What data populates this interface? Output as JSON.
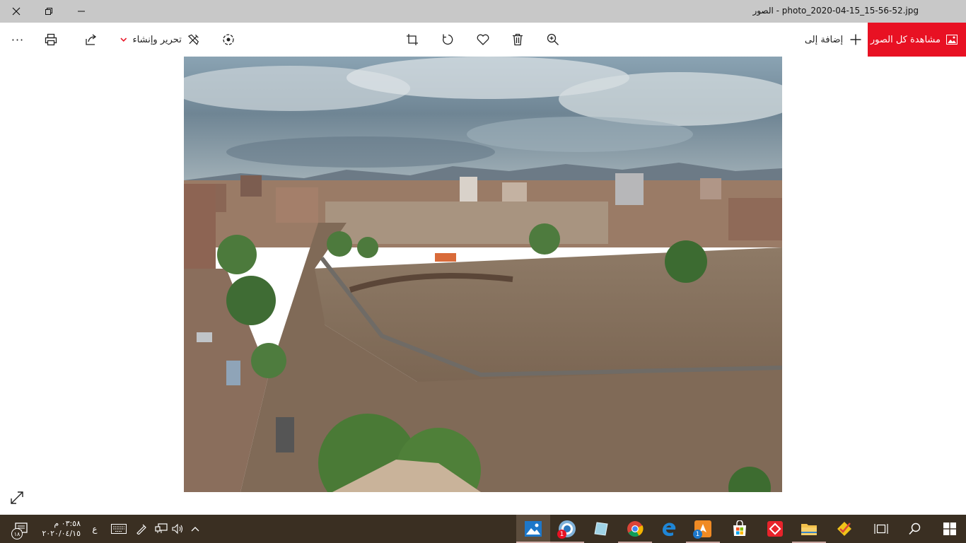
{
  "window": {
    "title": "الصور - photo_2020-04-15_15-56-52.jpg"
  },
  "toolbar": {
    "view_all_label": "مشاهدة كل الصور",
    "add_to_label": "إضافة إلى",
    "edit_create_label": "تحرير وإنشاء",
    "more_label": "···"
  },
  "taskbar": {
    "time": "٠٣:٥٨ م",
    "date": "٢٠٢٠/٠٤/١٥",
    "notification_count": "١٨",
    "input_language": "ع",
    "badge_1": "1",
    "badge_2": "1"
  },
  "colors": {
    "accent": "#e81123",
    "titlebar": "#c8c8c8",
    "taskbar": "#3a2f22"
  }
}
